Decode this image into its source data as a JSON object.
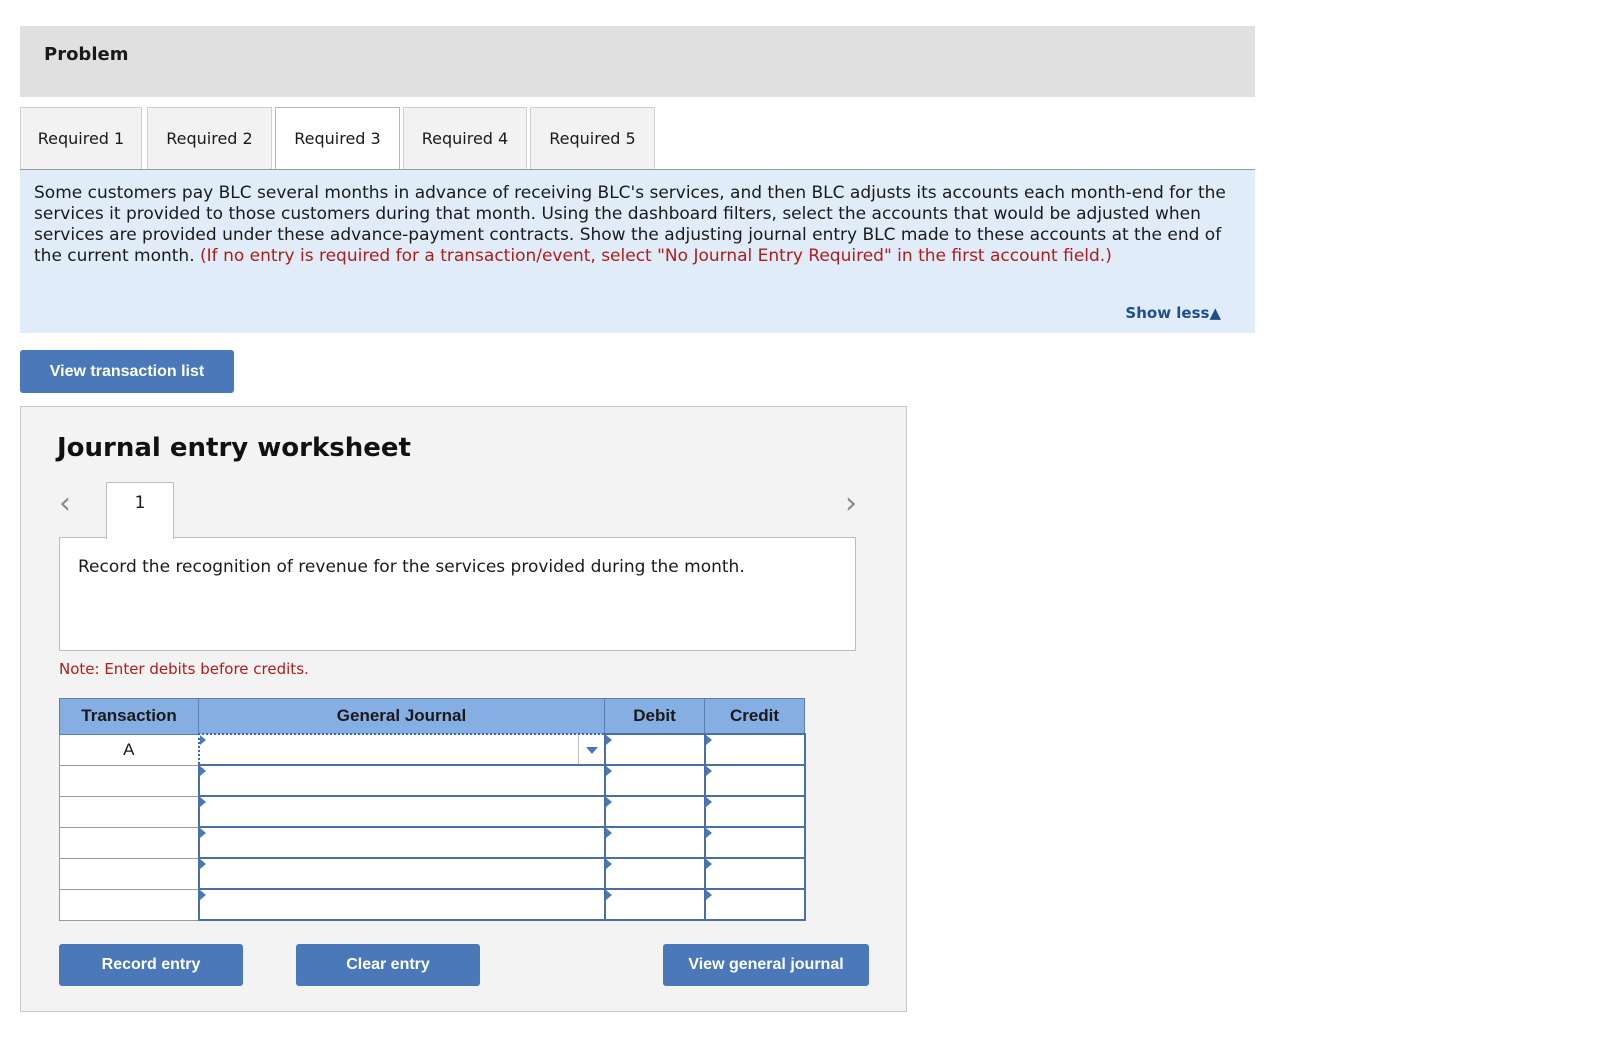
{
  "problem": {
    "title": "Problem"
  },
  "tabs": [
    {
      "label": "Required 1"
    },
    {
      "label": "Required 2"
    },
    {
      "label": "Required 3",
      "active": true
    },
    {
      "label": "Required 4"
    },
    {
      "label": "Required 5"
    }
  ],
  "instructions": {
    "text": "Some customers pay BLC several months in advance of receiving BLC's services, and then BLC adjusts its accounts each month-end for the services it provided to those customers during that month. Using the dashboard filters, select the accounts that would be adjusted when services are provided under these advance-payment contracts. Show the adjusting journal entry BLC made to these accounts at the end of the current month.",
    "note": "(If no entry is required for a transaction/event, select \"No Journal Entry Required\" in the first account field.)",
    "show_less": "Show less▲"
  },
  "buttons": {
    "view_transaction_list": "View transaction list",
    "record_entry": "Record entry",
    "clear_entry": "Clear entry",
    "view_general_journal": "View general journal"
  },
  "worksheet": {
    "title": "Journal entry worksheet",
    "prev_icon": "chevron-left-icon",
    "next_icon": "chevron-right-icon",
    "page_tab": "1",
    "task": "Record the recognition of revenue for the services provided during the month.",
    "note": "Note: Enter debits before credits."
  },
  "journal_table": {
    "headers": {
      "transaction": "Transaction",
      "general_journal": "General Journal",
      "debit": "Debit",
      "credit": "Credit"
    },
    "rows": [
      {
        "transaction": "A",
        "account": "",
        "debit": "",
        "credit": ""
      },
      {
        "transaction": "",
        "account": "",
        "debit": "",
        "credit": ""
      },
      {
        "transaction": "",
        "account": "",
        "debit": "",
        "credit": ""
      },
      {
        "transaction": "",
        "account": "",
        "debit": "",
        "credit": ""
      },
      {
        "transaction": "",
        "account": "",
        "debit": "",
        "credit": ""
      },
      {
        "transaction": "",
        "account": "",
        "debit": "",
        "credit": ""
      }
    ]
  }
}
